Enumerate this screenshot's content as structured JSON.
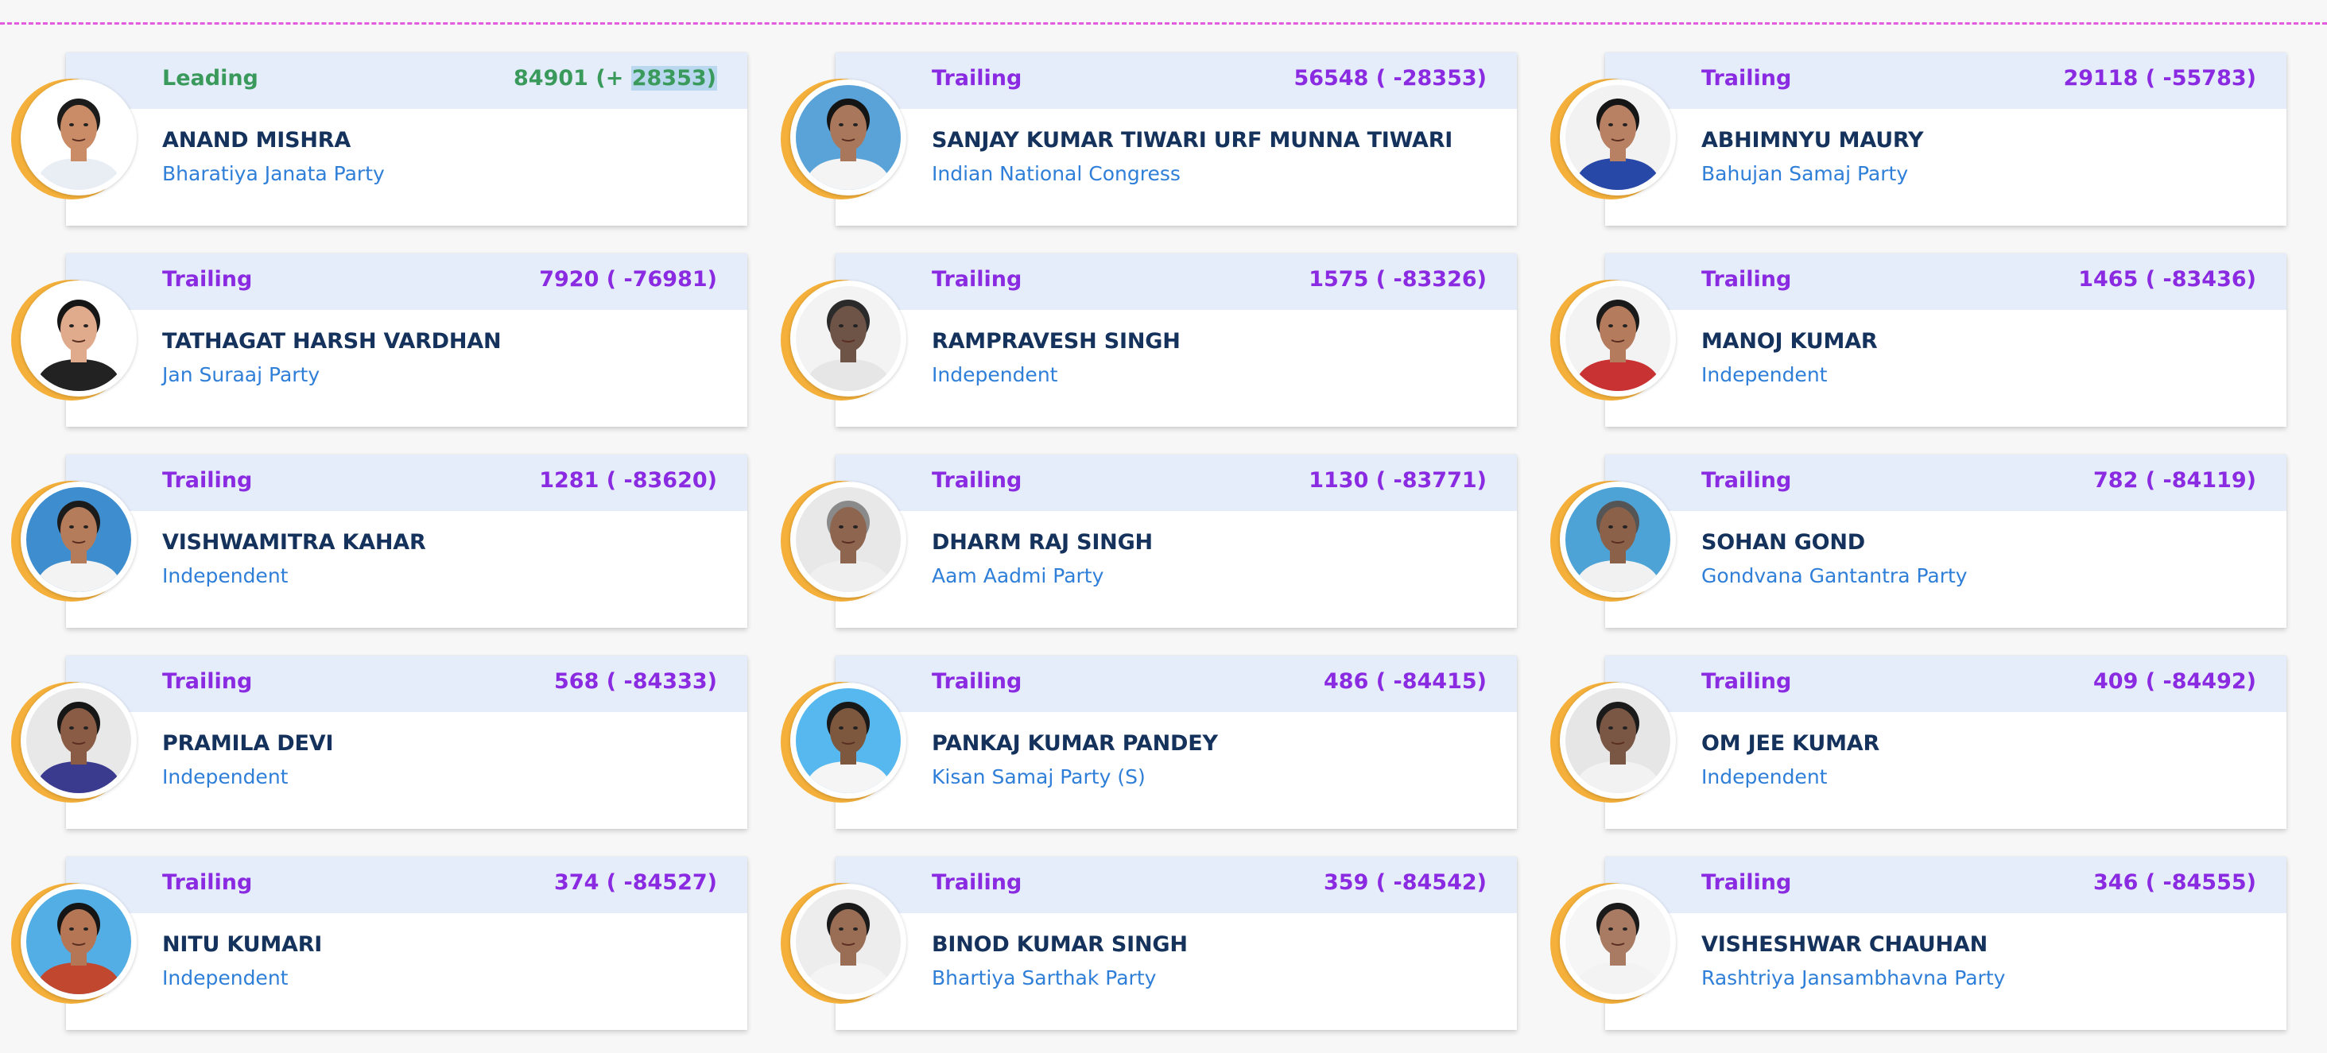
{
  "colors": {
    "leading": "#3a9a5b",
    "trailing": "#8a2be2",
    "name": "#14325c",
    "party": "#2f7fd9",
    "card_header": "#e5edfb",
    "ring": "#f4b03a",
    "divider": "#e35ce0"
  },
  "candidates": [
    {
      "status": "Leading",
      "votes": "84901 (+ 28353)",
      "votes_main": "84901 (+ ",
      "votes_highlight": "28353)",
      "name": "ANAND MISHRA",
      "party": "Bharatiya Janata Party",
      "photo_bg": "#ffffff",
      "skin": "#c98c66",
      "shirt": "#e9eef5",
      "hair": "#1b1b1b"
    },
    {
      "status": "Trailing",
      "votes": "56548 ( -28353)",
      "name": "SANJAY KUMAR TIWARI URF MUNNA TIWARI",
      "party": "Indian National Congress",
      "photo_bg": "#59a3d8",
      "skin": "#a9785c",
      "shirt": "#f4f4f4",
      "hair": "#141414"
    },
    {
      "status": "Trailing",
      "votes": "29118 ( -55783)",
      "name": "ABHIMNYU MAURY",
      "party": "Bahujan Samaj Party",
      "photo_bg": "#f2f2f2",
      "skin": "#b98163",
      "shirt": "#2848a8",
      "hair": "#151515"
    },
    {
      "status": "Trailing",
      "votes": "7920 ( -76981)",
      "name": "TATHAGAT HARSH VARDHAN",
      "party": "Jan Suraaj Party",
      "photo_bg": "#ffffff",
      "skin": "#e0aa8c",
      "shirt": "#222222",
      "hair": "#161616"
    },
    {
      "status": "Trailing",
      "votes": "1575 ( -83326)",
      "name": "RAMPRAVESH SINGH",
      "party": "Independent",
      "photo_bg": "#f3f3f3",
      "skin": "#6d5447",
      "shirt": "#e6e6e6",
      "hair": "#2a2a2a"
    },
    {
      "status": "Trailing",
      "votes": "1465 ( -83436)",
      "name": "MANOJ KUMAR",
      "party": "Independent",
      "photo_bg": "#f3f3f3",
      "skin": "#b57b5d",
      "shirt": "#c83232",
      "hair": "#1a1a1a"
    },
    {
      "status": "Trailing",
      "votes": "1281 ( -83620)",
      "name": "VISHWAMITRA KAHAR",
      "party": "Independent",
      "photo_bg": "#3e8ecf",
      "skin": "#b47c5a",
      "shirt": "#f3f3f3",
      "hair": "#1b1b1b"
    },
    {
      "status": "Trailing",
      "votes": "1130 ( -83771)",
      "name": "DHARM RAJ SINGH",
      "party": "Aam Aadmi Party",
      "photo_bg": "#e8e8e8",
      "skin": "#8e6650",
      "shirt": "#efefef",
      "hair": "#8a8a8a"
    },
    {
      "status": "Trailing",
      "votes": "782 ( -84119)",
      "name": "SOHAN GOND",
      "party": "Gondvana Gantantra Party",
      "photo_bg": "#4ea3d6",
      "skin": "#8b6249",
      "shirt": "#f1f1f1",
      "hair": "#555555"
    },
    {
      "status": "Trailing",
      "votes": "568 ( -84333)",
      "name": "PRAMILA DEVI",
      "party": "Independent",
      "photo_bg": "#e8e8e8",
      "skin": "#8a5c45",
      "shirt": "#3a3a8f",
      "hair": "#161616"
    },
    {
      "status": "Trailing",
      "votes": "486 ( -84415)",
      "name": "PANKAJ KUMAR PANDEY",
      "party": "Kisan Samaj Party (S)",
      "photo_bg": "#56b8ee",
      "skin": "#7e573f",
      "shirt": "#f5f5f5",
      "hair": "#181818"
    },
    {
      "status": "Trailing",
      "votes": "409 ( -84492)",
      "name": "OM JEE KUMAR",
      "party": "Independent",
      "photo_bg": "#e6e6e6",
      "skin": "#7a5645",
      "shirt": "#f2f2f2",
      "hair": "#1a1a1a"
    },
    {
      "status": "Trailing",
      "votes": "374 ( -84527)",
      "name": "NITU KUMARI",
      "party": "Independent",
      "photo_bg": "#52aee4",
      "skin": "#b57656",
      "shirt": "#c2472f",
      "hair": "#151515"
    },
    {
      "status": "Trailing",
      "votes": "359 ( -84542)",
      "name": "BINOD KUMAR SINGH",
      "party": "Bhartiya Sarthak Party",
      "photo_bg": "#ededed",
      "skin": "#9a6e55",
      "shirt": "#f4f4f4",
      "hair": "#1a1a1a"
    },
    {
      "status": "Trailing",
      "votes": "346 ( -84555)",
      "name": "VISHESHWAR CHAUHAN",
      "party": "Rashtriya Jansambhavna Party",
      "photo_bg": "#f6f6f6",
      "skin": "#a97b62",
      "shirt": "#f3f3f3",
      "hair": "#1a1a1a"
    }
  ]
}
